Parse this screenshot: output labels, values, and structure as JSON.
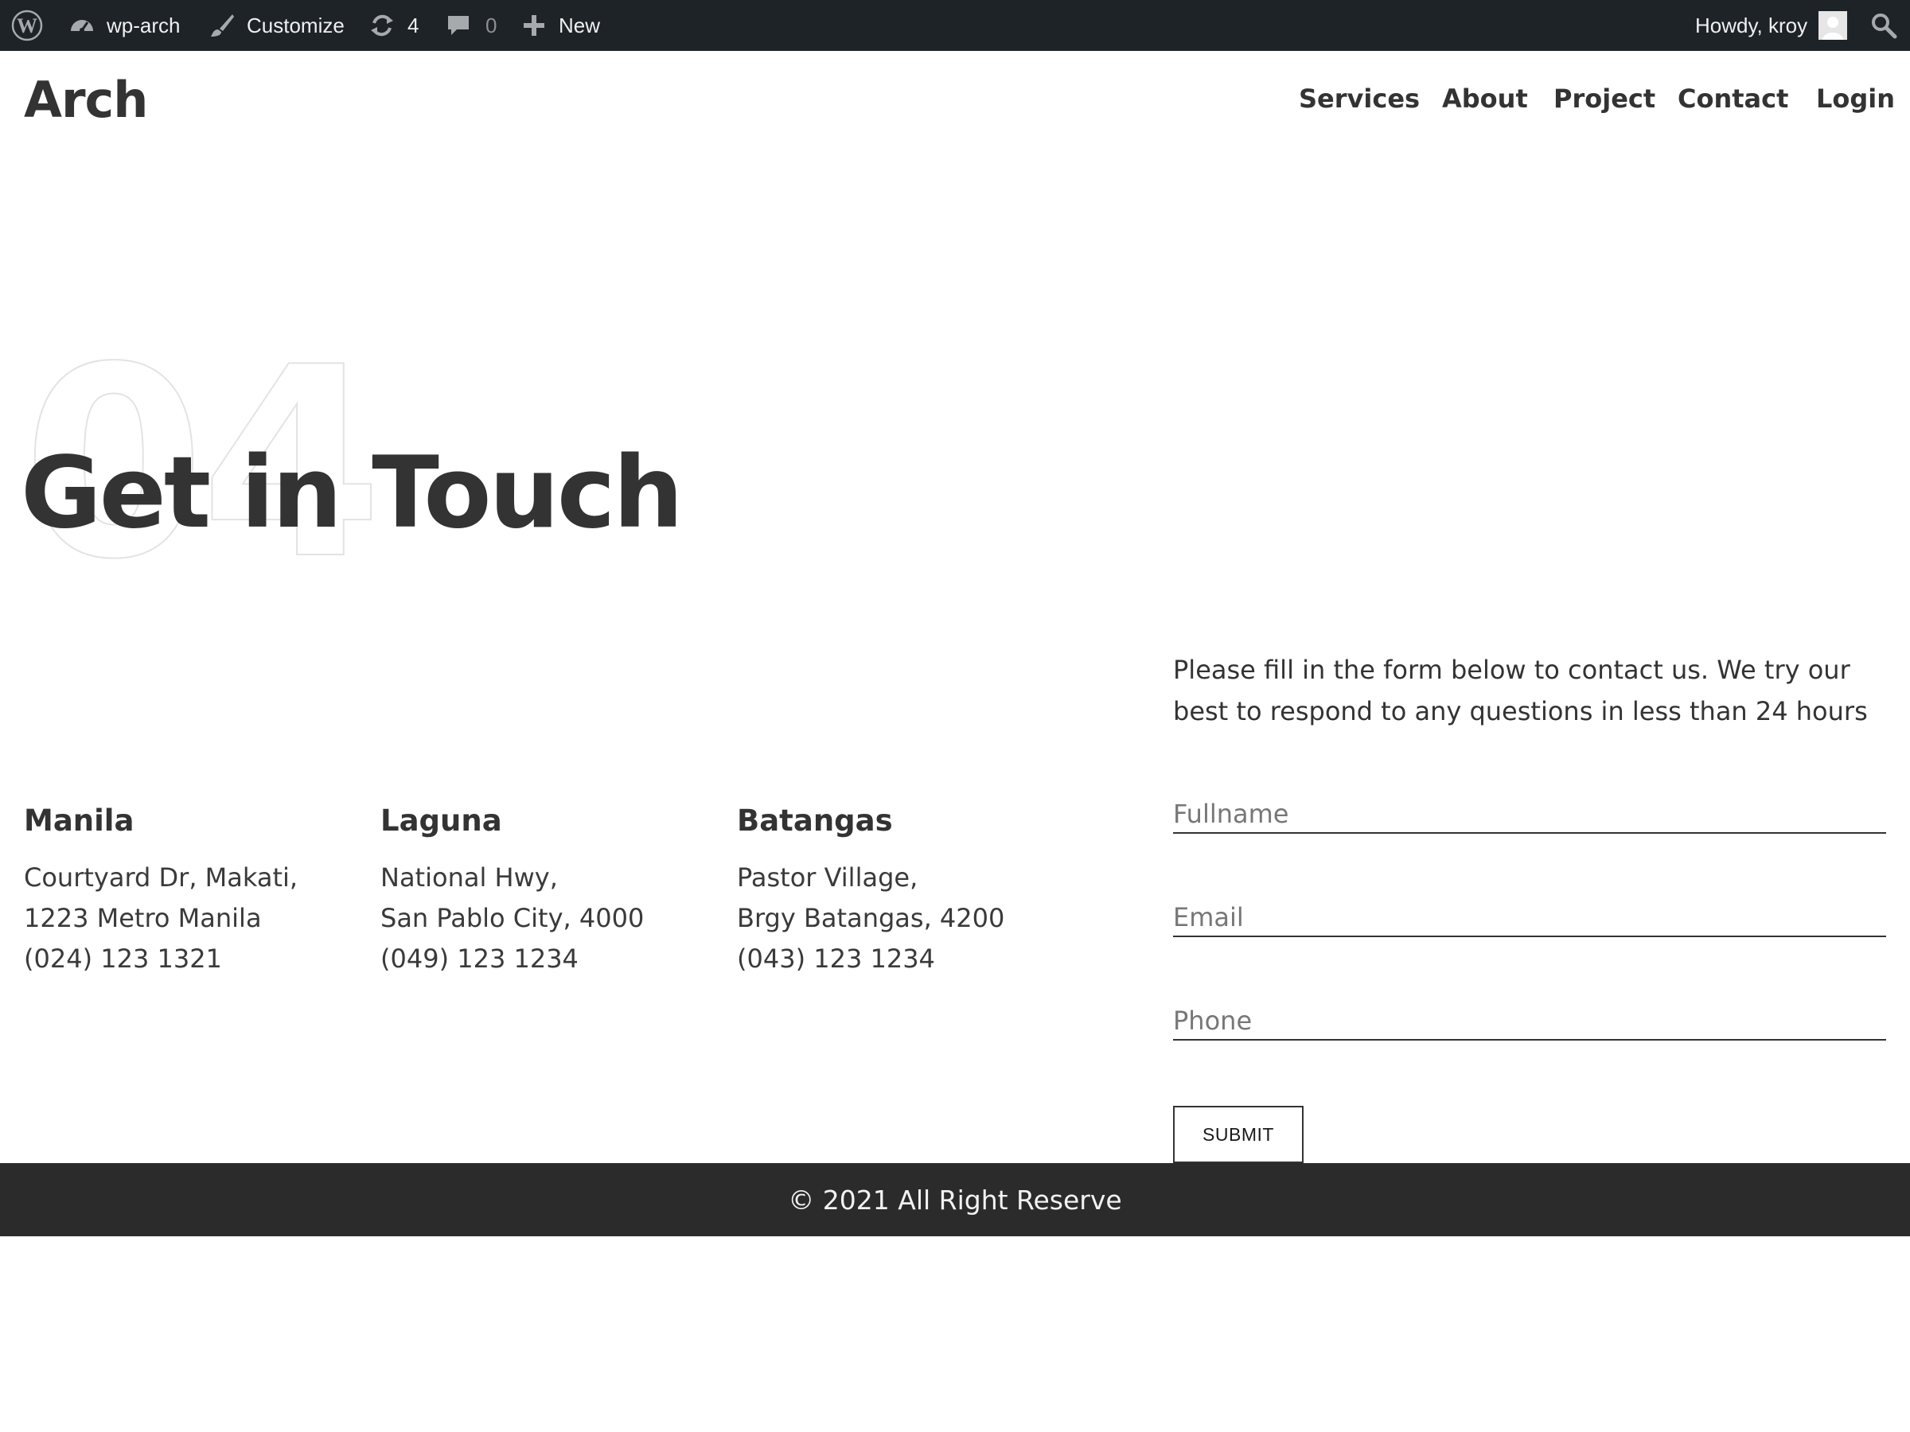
{
  "admin_bar": {
    "site_name": "wp-arch",
    "customize_label": "Customize",
    "updates_count": "4",
    "comments_count": "0",
    "new_label": "New",
    "greeting": "Howdy, kroy"
  },
  "header": {
    "site_title": "Arch",
    "nav": [
      "Services",
      "About",
      "Project",
      "Contact",
      "Login"
    ]
  },
  "hero": {
    "number": "04",
    "title": "Get in Touch"
  },
  "locations": [
    {
      "city": "Manila",
      "line1": "Courtyard Dr, Makati,",
      "line2": "1223 Metro Manila",
      "phone": "(024) 123 1321"
    },
    {
      "city": "Laguna",
      "line1": "National Hwy,",
      "line2": "San Pablo City, 4000",
      "phone": "(049) 123 1234"
    },
    {
      "city": "Batangas",
      "line1": "Pastor Village,",
      "line2": "Brgy Batangas, 4200",
      "phone": "(043) 123 1234"
    }
  ],
  "form": {
    "intro": "Please fill in the form below to contact us. We try our best to respond to any questions in less than 24 hours",
    "fullname_placeholder": "Fullname",
    "email_placeholder": "Email",
    "phone_placeholder": "Phone",
    "submit_label": "SUBMIT"
  },
  "footer": {
    "copyright": "© 2021 All Right Reserve"
  }
}
